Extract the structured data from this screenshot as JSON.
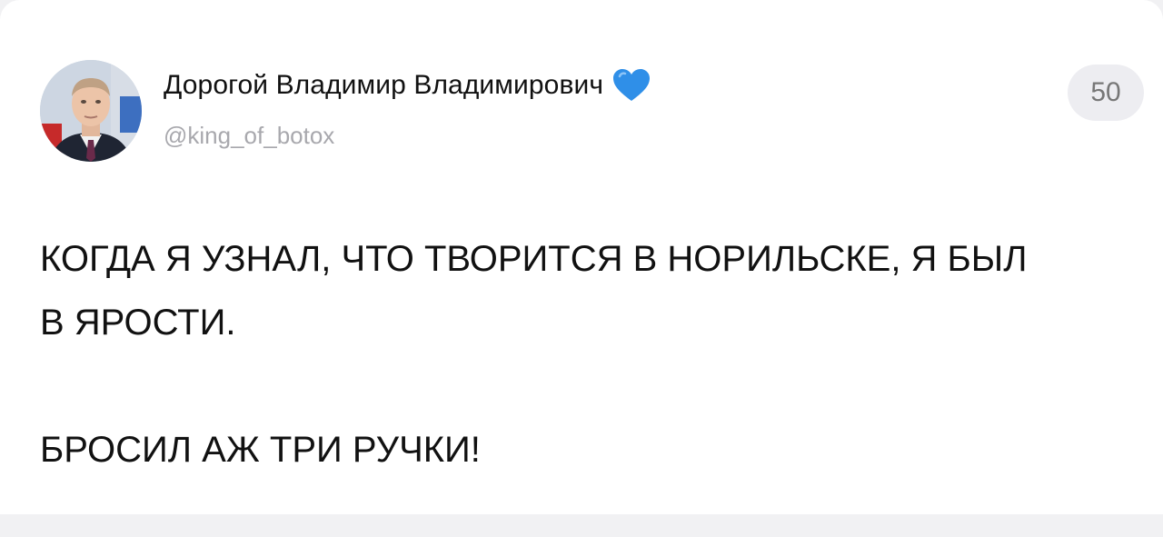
{
  "post": {
    "author_name": "Дорогой Владимир Владимирович",
    "author_handle": "@king_of_botox",
    "verified_icon": "blue-heart-icon",
    "count": "50",
    "text_lines": [
      "КОГДА Я УЗНАЛ, ЧТО ТВОРИТСЯ В НОРИЛЬСКЕ, Я БЫЛ",
      "В ЯРОСТИ."
    ],
    "text_last": "БРОСИЛ АЖ ТРИ РУЧКИ!"
  },
  "colors": {
    "heart": "#2f8fe8",
    "badge_bg": "#ededf1",
    "handle": "#a8a8ad"
  }
}
